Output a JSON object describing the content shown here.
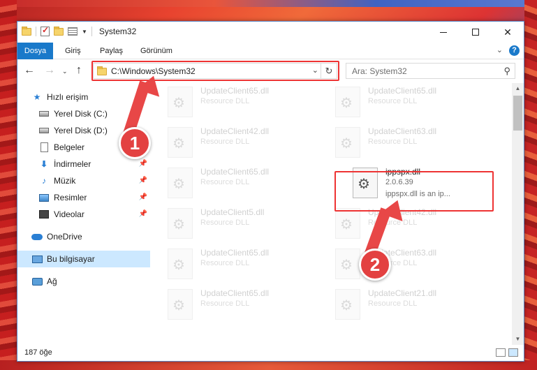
{
  "window": {
    "title": "System32",
    "controls": {
      "minimize": "",
      "maximize": "",
      "close": "✕"
    }
  },
  "ribbon": {
    "tabs": [
      "Dosya",
      "Giriş",
      "Paylaş",
      "Görünüm"
    ],
    "help": "?"
  },
  "navbar": {
    "address": "C:\\Windows\\System32",
    "search_placeholder": "Ara: System32"
  },
  "sidebar": {
    "items": [
      {
        "label": "Hızlı erişim",
        "icon": "star-icon"
      },
      {
        "label": "Yerel Disk (C:)",
        "icon": "disk-icon"
      },
      {
        "label": "Yerel Disk (D:)",
        "icon": "disk-icon"
      },
      {
        "label": "Belgeler",
        "icon": "document-icon"
      },
      {
        "label": "İndirmeler",
        "icon": "download-icon"
      },
      {
        "label": "Müzik",
        "icon": "music-icon"
      },
      {
        "label": "Resimler",
        "icon": "picture-icon"
      },
      {
        "label": "Videolar",
        "icon": "video-icon"
      },
      {
        "label": "OneDrive",
        "icon": "cloud-icon"
      },
      {
        "label": "Bu bilgisayar",
        "icon": "computer-icon"
      },
      {
        "label": "Ağ",
        "icon": "network-icon"
      }
    ]
  },
  "files": [
    {
      "name": "UpdateClient65.dll",
      "type": "Resource DLL"
    },
    {
      "name": "UpdateClient65.dll",
      "type": "Resource DLL"
    },
    {
      "name": "UpdateClient42.dll",
      "type": "Resource DLL"
    },
    {
      "name": "UpdateClient63.dll",
      "type": "Resource DLL"
    },
    {
      "name": "UpdateClient65.dll",
      "type": "Resource DLL"
    },
    {
      "name": "ippspx.dll",
      "version": "2.0.6.39",
      "desc": "ippspx.dll is an ip..."
    },
    {
      "name": "UpdateClient5.dll",
      "type": "Resource DLL"
    },
    {
      "name": "UpdateClient42.dll",
      "type": "Resource DLL"
    },
    {
      "name": "UpdateClient65.dll",
      "type": "Resource DLL"
    },
    {
      "name": "UpdateClient63.dll",
      "type": "Resource DLL"
    },
    {
      "name": "UpdateClient65.dll",
      "type": "Resource DLL"
    },
    {
      "name": "UpdateClient21.dll",
      "type": "Resource DLL"
    }
  ],
  "status": {
    "count": "187 öğe"
  },
  "annotations": {
    "step1": "1",
    "step2": "2",
    "color": "#e34141"
  }
}
